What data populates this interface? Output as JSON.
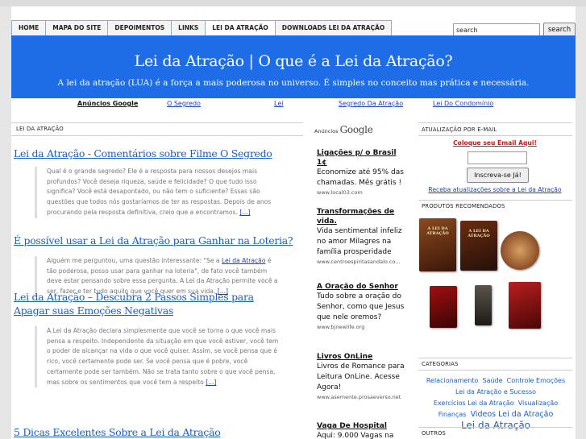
{
  "nav": {
    "tabs": [
      {
        "label": "HOME"
      },
      {
        "label": "MAPA DO SITE"
      },
      {
        "label": "DEPOIMENTOS"
      },
      {
        "label": "LINKS"
      },
      {
        "label": "LEI DA ATRAÇÃO",
        "active": true
      },
      {
        "label": "DOWNLOADS LEI DA ATRAÇÃO"
      }
    ],
    "search_value": "search",
    "search_button": "search"
  },
  "header": {
    "title": "Lei da Atração | O que é a Lei da Atração?",
    "description": "A lei da atração (LUA) é a força a mais poderosa no universo. É simples no conceito mas prática e necessária.",
    "color": "#1f6de6"
  },
  "adlinks": {
    "label": "Anúncios Google",
    "links": [
      "O Segredo",
      "Lei",
      "Segredo Da Atração",
      "Lei Do Condomínio"
    ]
  },
  "main": {
    "heading": "LEI DA ATRAÇÃO",
    "posts": [
      {
        "title": "Lei da Atração - Comentários sobre Filme O Segredo",
        "excerpt": "Qual é o grande segredo? Ele é a resposta para nossos desejos mais profundos? Você deseja riqueza, saúde e felicidade? O que tudo isso significa? Você está desapontado, ou não tem o suficiente? Essas são questões que todos nós gostaríamos de ter as respostas. Depois de anos procurando pela resposta definitiva, creio que a encontramos.",
        "more": "[...]"
      },
      {
        "title": "É possível usar a Lei da Atração para Ganhar na Loteria?",
        "excerpt_before": "Alguém me perguntou, uma questão interessante: \"Se a ",
        "excerpt_link": "Lei da Atração",
        "excerpt_after": " é tão poderosa, posso usar para ganhar na loteria\", de fato você também deve estar pensando sobre essa pergunta. A Lei da Atração permite você a ser, fazer e ter tudo aquilo que você quer em sua vida.",
        "more": "[...]"
      },
      {
        "title": "Lei da Atração – Descubra 2 Passos Simples para Apagar suas Emoções Negativas",
        "excerpt": "A Lei da Atração declara simplesmente que você se torna o que você mais pensa a respeito. Independente da situação em que você estiver, você tem o poder de alcançar na vida o que você quiser. Assim, se você pensa que é rico, você certamente pode ser. Se você pensa que é pobre, você certamente pode ser também. Não se trata tanto sobre o que você pensa, mas sobre os sentimentos que você tem a respeito",
        "more": "[...]"
      },
      {
        "title": "5 Dicas Excelentes Sobre a Lei da Atração"
      }
    ]
  },
  "ads": {
    "label": "Anúncios",
    "brand": "Google",
    "items": [
      {
        "title": "Ligações p/ o Brasil 1¢",
        "text": "Economize até 95% das chamadas. Mês grátis !",
        "url": "www.local03.com"
      },
      {
        "title": "Transformações de vida.",
        "text": "Vida sentimental infeliz no amor Milagres na família prosperidade",
        "url": "www.centroespiritasandalo.co..."
      },
      {
        "title": "A Oração do Senhor",
        "text": "Tudo sobre a oração do Senhor, como que Jesus que nele oremos?",
        "url": "www.bjnewlife.org"
      },
      {
        "title": "Livros OnLine",
        "text": "Livros de Romance para Leitura OnLine. Acesse Agora!",
        "url": "www.asemente.prosaeverso.net"
      },
      {
        "title": "Vaga De Hospital",
        "text": "Aqui: 9.000 Vagas na",
        "url": ""
      }
    ]
  },
  "sidebar": {
    "email_heading": "ATUALIZAÇÃO POR E-MAIL",
    "email_note": "Coloque seu Email Aqui!",
    "subscribe_button": "Inscreva-se Já!",
    "subscribe_link": "Receba atualizações sobre a Lei da Atração",
    "products_heading": "PRODUTOS RECOMENDADOS",
    "books": [
      {
        "title": "A LEI DA ATRAÇÃO",
        "color": "#5a2a14"
      },
      {
        "title": "A LEI DA ATRAÇÃO",
        "color": "#3b1a0c"
      },
      {
        "title": "",
        "color": "#7a3a1a"
      },
      {
        "title": "",
        "color": "#5c0a0a"
      },
      {
        "title": "",
        "color": "#2e2a26"
      },
      {
        "title": "",
        "color": "#6b1212"
      }
    ],
    "categories_heading": "CATEGORIAS",
    "categories": [
      {
        "label": "Relacionamento",
        "size": "s"
      },
      {
        "label": "Saúde",
        "size": "s"
      },
      {
        "label": "Controle Emoções",
        "size": "s"
      },
      {
        "label": "Lei da Atração e Sucesso",
        "size": "s"
      },
      {
        "label": "Exercícios Lei da Atração",
        "size": "s"
      },
      {
        "label": "Visualização",
        "size": "s"
      },
      {
        "label": "Finanças",
        "size": "s"
      },
      {
        "label": "Videos Lei da Atração",
        "size": "m"
      },
      {
        "label": "Lei da Atração",
        "size": "l"
      }
    ],
    "others_heading": "OUTROS"
  }
}
